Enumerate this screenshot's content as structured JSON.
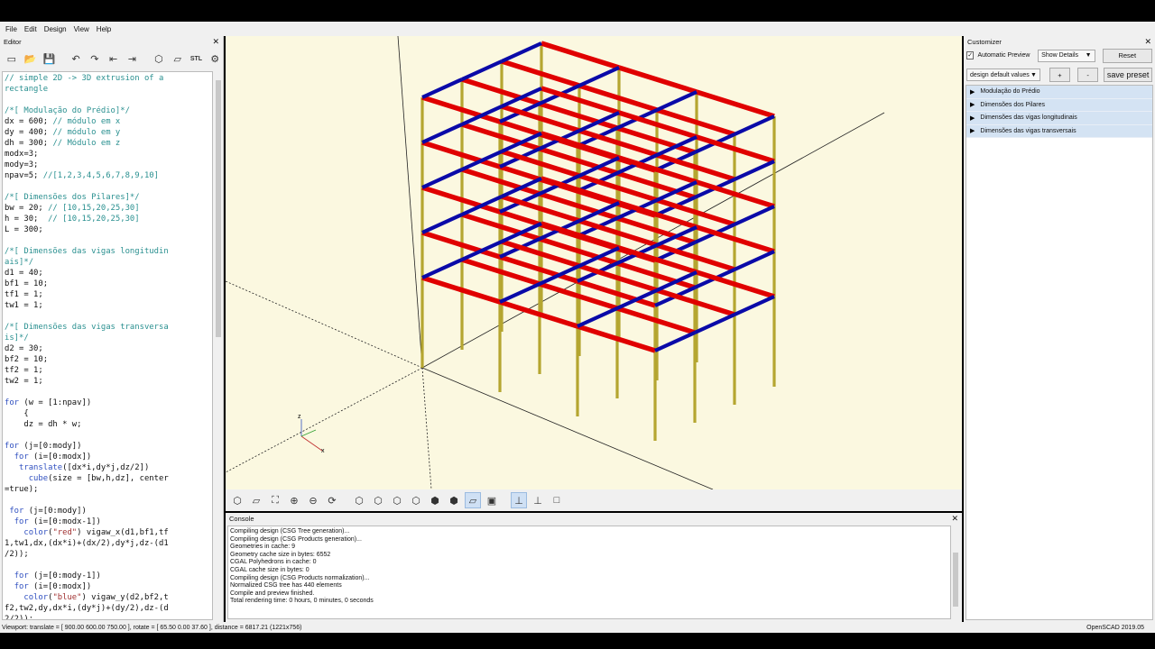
{
  "menu": [
    "File",
    "Edit",
    "Design",
    "View",
    "Help"
  ],
  "editor": {
    "title": "Editor",
    "code_lines": [
      [
        [
          "cmt",
          "// simple 2D -> 3D extrusion of a"
        ]
      ],
      [
        [
          "cmt",
          "rectangle"
        ]
      ],
      [
        [
          "",
          ""
        ]
      ],
      [
        [
          "cmt",
          "/*[ Modulação do Prédio]*/"
        ]
      ],
      [
        [
          "",
          "dx = 600; "
        ],
        [
          "cmt",
          "// módulo em x"
        ]
      ],
      [
        [
          "",
          "dy = 400; "
        ],
        [
          "cmt",
          "// módulo em y"
        ]
      ],
      [
        [
          "",
          "dh = 300; "
        ],
        [
          "cmt",
          "// Módulo em z"
        ]
      ],
      [
        [
          "",
          "modx=3;"
        ]
      ],
      [
        [
          "",
          "mody=3;"
        ]
      ],
      [
        [
          "",
          "npav=5; "
        ],
        [
          "cmt",
          "//[1,2,3,4,5,6,7,8,9,10]"
        ]
      ],
      [
        [
          "",
          ""
        ]
      ],
      [
        [
          "cmt",
          "/*[ Dimensões dos Pilares]*/"
        ]
      ],
      [
        [
          "",
          "bw = 20; "
        ],
        [
          "cmt",
          "// [10,15,20,25,30]"
        ]
      ],
      [
        [
          "",
          "h = 30;  "
        ],
        [
          "cmt",
          "// [10,15,20,25,30]"
        ]
      ],
      [
        [
          "",
          "L = 300;"
        ]
      ],
      [
        [
          "",
          ""
        ]
      ],
      [
        [
          "cmt",
          "/*[ Dimensões das vigas longitudin"
        ]
      ],
      [
        [
          "cmt",
          "ais]*/"
        ]
      ],
      [
        [
          "",
          "d1 = 40;"
        ]
      ],
      [
        [
          "",
          "bf1 = 10;"
        ]
      ],
      [
        [
          "",
          "tf1 = 1;"
        ]
      ],
      [
        [
          "",
          "tw1 = 1;"
        ]
      ],
      [
        [
          "",
          ""
        ]
      ],
      [
        [
          "cmt",
          "/*[ Dimensões das vigas transversa"
        ]
      ],
      [
        [
          "cmt",
          "is]*/"
        ]
      ],
      [
        [
          "",
          "d2 = 30;"
        ]
      ],
      [
        [
          "",
          "bf2 = 10;"
        ]
      ],
      [
        [
          "",
          "tf2 = 1;"
        ]
      ],
      [
        [
          "",
          "tw2 = 1;"
        ]
      ],
      [
        [
          "",
          ""
        ]
      ],
      [
        [
          "kw",
          "for"
        ],
        [
          "",
          " (w = [1:npav])"
        ]
      ],
      [
        [
          "",
          "    {"
        ]
      ],
      [
        [
          "",
          "    dz = dh * w;"
        ]
      ],
      [
        [
          "",
          ""
        ]
      ],
      [
        [
          "kw",
          "for"
        ],
        [
          "",
          " (j=[0:mody])"
        ]
      ],
      [
        [
          "",
          "  "
        ],
        [
          "kw",
          "for"
        ],
        [
          "",
          " (i=[0:modx])"
        ]
      ],
      [
        [
          "",
          "   "
        ],
        [
          "kw",
          "translate"
        ],
        [
          "",
          "([dx*i,dy*j,dz/2])"
        ]
      ],
      [
        [
          "",
          "     "
        ],
        [
          "kw",
          "cube"
        ],
        [
          "",
          "(size = [bw,h,dz], center"
        ]
      ],
      [
        [
          "",
          "=true);"
        ]
      ],
      [
        [
          "",
          ""
        ]
      ],
      [
        [
          "",
          ""
        ],
        [
          "kw",
          " for"
        ],
        [
          "",
          " (j=[0:mody])"
        ]
      ],
      [
        [
          "",
          "  "
        ],
        [
          "kw",
          "for"
        ],
        [
          "",
          " (i=[0:modx-1])"
        ]
      ],
      [
        [
          "",
          "    "
        ],
        [
          "kw",
          "color"
        ],
        [
          "",
          "("
        ],
        [
          "str",
          "\"red\""
        ],
        [
          "",
          ") vigaw_x(d1,bf1,tf"
        ]
      ],
      [
        [
          "",
          "1,tw1,dx,(dx*i)+(dx/2),dy*j,dz-(d1"
        ]
      ],
      [
        [
          "",
          "/2));"
        ]
      ],
      [
        [
          "",
          ""
        ]
      ],
      [
        [
          "",
          "  "
        ],
        [
          "kw",
          "for"
        ],
        [
          "",
          " (j=[0:mody-1])"
        ]
      ],
      [
        [
          "",
          "  "
        ],
        [
          "kw",
          "for"
        ],
        [
          "",
          " (i=[0:modx])"
        ]
      ],
      [
        [
          "",
          "    "
        ],
        [
          "kw",
          "color"
        ],
        [
          "",
          "("
        ],
        [
          "str",
          "\"blue\""
        ],
        [
          "",
          ") vigaw_y(d2,bf2,t"
        ]
      ],
      [
        [
          "",
          "f2,tw2,dy,dx*i,(dy*j)+(dy/2),dz-(d"
        ]
      ],
      [
        [
          "",
          "2/2));"
        ]
      ]
    ]
  },
  "console": {
    "title": "Console",
    "lines": [
      "Compiling design (CSG Tree generation)...",
      "Compiling design (CSG Products generation)...",
      "Geometries in cache: 9",
      "Geometry cache size in bytes: 6552",
      "CGAL Polyhedrons in cache: 0",
      "CGAL cache size in bytes: 0",
      "Compiling design (CSG Products normalization)...",
      "Normalized CSG tree has 440 elements",
      "Compile and preview finished.",
      "Total rendering time: 0 hours, 0 minutes, 0 seconds"
    ]
  },
  "customizer": {
    "title": "Customizer",
    "auto_preview_label": "Automatic Preview",
    "auto_preview_checked": "✓",
    "show_details": "Show Details",
    "reset_label": "Reset",
    "preset": "design default values",
    "plus_label": "+",
    "minus_label": "-",
    "save_preset_label": "save preset",
    "groups": [
      "Modulação do Prédio",
      "Dimensões dos Pilares",
      "Dimensões das vigas longitudinais",
      "Dimensões das vigas transversais"
    ]
  },
  "status": {
    "viewport": "Viewport: translate = [ 900.00 600.00 750.00 ], rotate = [ 65.50 0.00 37.60 ], distance = 6817.21 (1221x756)",
    "version": "OpenSCAD 2019.05"
  },
  "colors": {
    "column": "#b5a630",
    "beam_x": "#e00000",
    "beam_y": "#0a0aa8",
    "viewport_bg": "#fbf8e0"
  },
  "axis_labels": {
    "x": "x",
    "z": "z"
  },
  "close_glyph": "✕"
}
